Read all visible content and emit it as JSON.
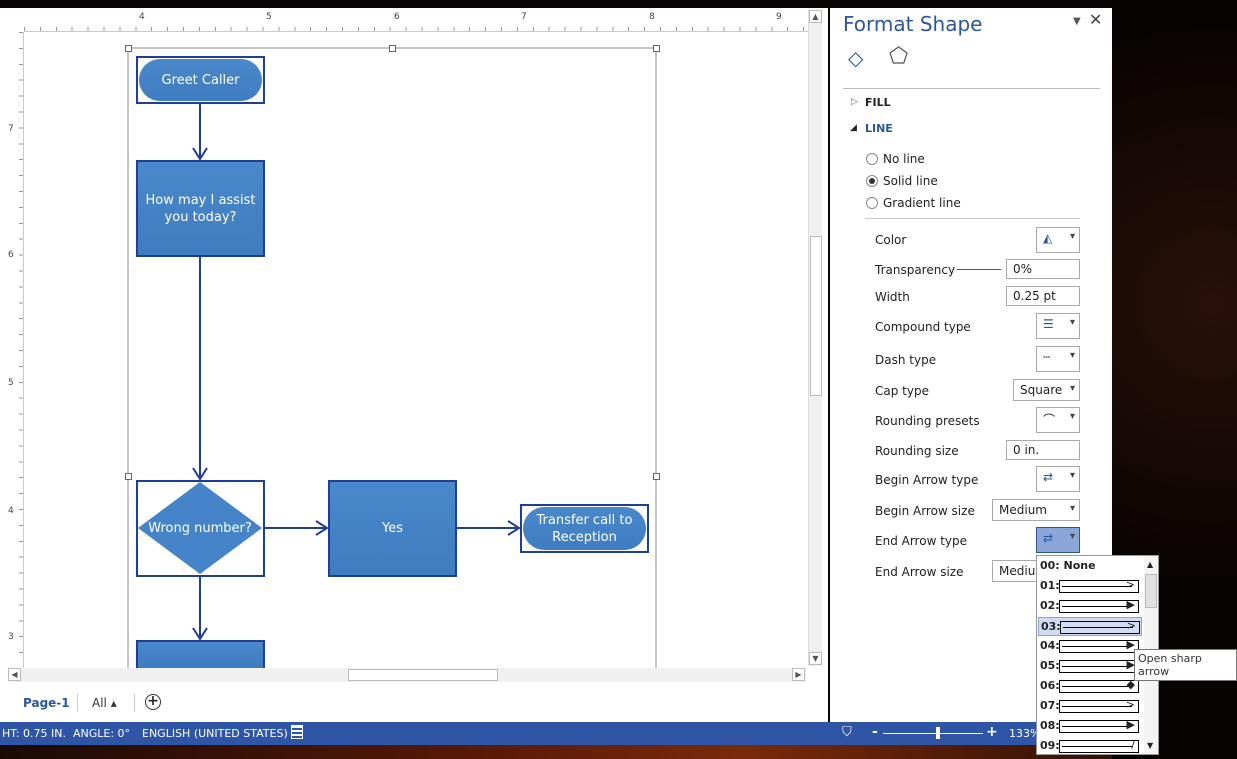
{
  "ruler": {
    "h": [
      "4",
      "5",
      "6",
      "7",
      "8",
      "9"
    ],
    "v": [
      "7",
      "6",
      "5",
      "4",
      "3"
    ]
  },
  "shapes": {
    "greet": "Greet Caller",
    "assist": "How may I assist you today?",
    "wrong": "Wrong number?",
    "yes": "Yes",
    "transfer": "Transfer call to Reception"
  },
  "tabs": {
    "page": "Page-1",
    "all": "All ▴",
    "add_icon": "plus-circle-icon"
  },
  "status": {
    "height": "HT: 0.75 IN.",
    "angle": "ANGLE: 0°",
    "language": "ENGLISH (UNITED STATES)",
    "zoom_minus": "-",
    "zoom_plus": "+",
    "zoom": "133%",
    "zoom_level_percent": 133
  },
  "pane": {
    "title": "Format Shape",
    "fill": "FILL",
    "line": "LINE",
    "radios": [
      {
        "label": "No line",
        "checked": false
      },
      {
        "label": "Solid line",
        "checked": true
      },
      {
        "label": "Gradient line",
        "checked": false
      }
    ],
    "props": {
      "color": "Color",
      "transparency": "Transparency",
      "transparency_value": "0%",
      "width": "Width",
      "width_value": "0.25 pt",
      "compound": "Compound type",
      "dash": "Dash type",
      "cap": "Cap type",
      "cap_value": "Square",
      "rpresets": "Rounding presets",
      "rsize": "Rounding size",
      "rsize_value": "0 in.",
      "begin_type": "Begin Arrow type",
      "begin_size": "Begin Arrow size",
      "begin_size_value": "Medium",
      "end_type": "End Arrow type",
      "end_size": "End Arrow size",
      "end_size_value": "Medium"
    }
  },
  "dropdown": {
    "options": [
      {
        "label": "00: None"
      },
      {
        "label": "01:",
        "head": ">"
      },
      {
        "label": "02:",
        "head": "▶"
      },
      {
        "label": "03:",
        "head": ">",
        "selected": true
      },
      {
        "label": "04:",
        "head": "▶"
      },
      {
        "label": "05:",
        "head": "▶"
      },
      {
        "label": "06:",
        "head": "◆"
      },
      {
        "label": "07:",
        "head": ">"
      },
      {
        "label": "08:",
        "head": "▶"
      },
      {
        "label": "09:",
        "head": "/"
      }
    ],
    "tooltip": "Open sharp arrow"
  },
  "colors": {
    "accent": "#2b579a",
    "status_bar": "#2f56a6",
    "shape_fill": "#4a88cc",
    "shape_border": "#1f3f95"
  }
}
